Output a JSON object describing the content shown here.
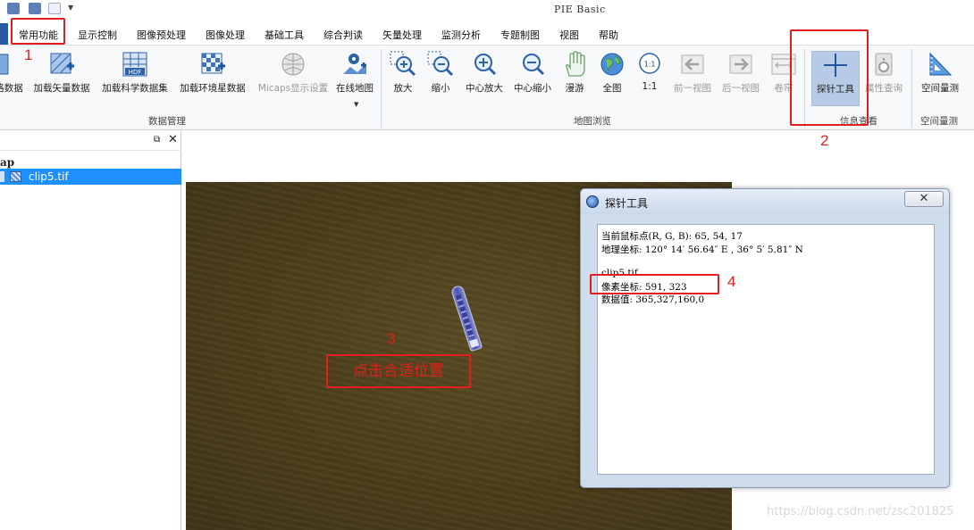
{
  "app": {
    "title": "PIE Basic"
  },
  "menu": {
    "items": [
      "常用功能",
      "显示控制",
      "图像预处理",
      "图像处理",
      "基础工具",
      "综合判读",
      "矢量处理",
      "监测分析",
      "专题制图",
      "视图",
      "帮助"
    ]
  },
  "ribbon": {
    "data_group": {
      "label": "数据管理",
      "buttons": [
        "格数据",
        "加载矢量数据",
        "加载科学数据集",
        "加载环境星数据",
        "Micaps显示设置",
        "在线地图"
      ]
    },
    "browse_group": {
      "label": "地图浏览",
      "buttons": [
        "放大",
        "缩小",
        "中心放大",
        "中心缩小",
        "漫游",
        "全图",
        "1:1",
        "前一视图",
        "后一视图",
        "卷帘"
      ],
      "ratio_icon_text": "1:1"
    },
    "info_group": {
      "label": "信息查看",
      "buttons": [
        "探针工具",
        "属性查询"
      ]
    },
    "measure_group": {
      "label": "空间量测",
      "buttons": [
        "空间量测"
      ]
    },
    "hdf_badge": "HDF"
  },
  "layers": {
    "root": "ap",
    "items": [
      {
        "name": "clip5.tif",
        "selected": true
      }
    ]
  },
  "probe_dialog": {
    "title": "探针工具",
    "close_label": "✕",
    "lines": [
      "当前鼠标点(R, G, B): 65, 54, 17",
      "地理坐标: 120° 14′ 56.64″ E , 36° 5′ 5.81″ N",
      "clip5.tif",
      "像素坐标: 591, 323",
      "数据值: 365,327,160,0"
    ]
  },
  "annotations": {
    "n1": "1",
    "n2": "2",
    "n3": "3",
    "n4": "4",
    "click_hint": "点击合适位置"
  },
  "watermark": "https://blog.csdn.net/zsc201825",
  "colors": {
    "annotation_red": "#e0201c",
    "selection_blue": "#1e90ff",
    "active_tool_bg": "#b8cbe6",
    "map_dark": "#4c3f1b"
  }
}
